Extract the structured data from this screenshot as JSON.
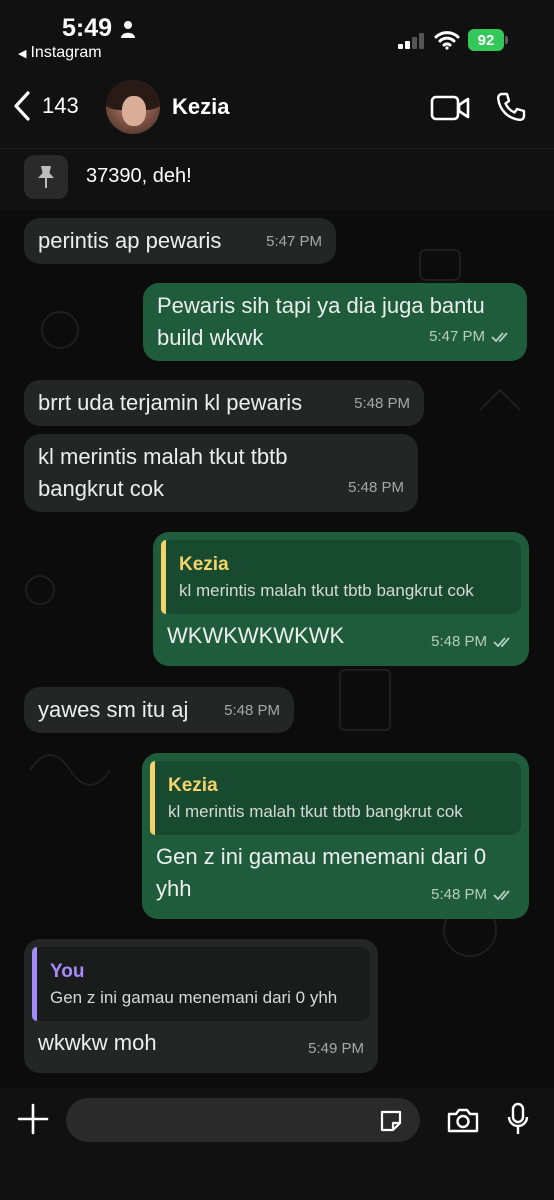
{
  "status_bar": {
    "time": "5:49",
    "back_app": "Instagram",
    "battery": "92"
  },
  "header": {
    "unread_count": "143",
    "contact_name": "Kezia"
  },
  "pinned": {
    "text": "37390, deh!"
  },
  "messages": [
    {
      "direction": "in",
      "lines": [
        "perintis ap pewaris"
      ],
      "time": "5:47 PM"
    },
    {
      "direction": "out",
      "lines": [
        "Pewaris sih tapi ya dia juga bantu",
        "build wkwk"
      ],
      "time": "5:47 PM"
    },
    {
      "direction": "in",
      "lines": [
        "brrt uda terjamin kl pewaris"
      ],
      "time": "5:48 PM"
    },
    {
      "direction": "in",
      "lines": [
        "kl merintis malah tkut tbtb",
        "bangkrut cok"
      ],
      "time": "5:48 PM"
    },
    {
      "direction": "out",
      "quote_author": "Kezia",
      "quote_text": "kl merintis malah tkut tbtb bangkrut cok",
      "lines": [
        "WKWKWKWKWK"
      ],
      "time": "5:48 PM"
    },
    {
      "direction": "in",
      "lines": [
        "yawes sm itu aj"
      ],
      "time": "5:48 PM"
    },
    {
      "direction": "out",
      "quote_author": "Kezia",
      "quote_text": "kl merintis malah tkut tbtb bangkrut cok",
      "lines": [
        "Gen z ini gamau menemani dari 0",
        "yhh"
      ],
      "time": "5:48 PM"
    },
    {
      "direction": "in",
      "quote_author": "You",
      "quote_text": "Gen z ini gamau menemani dari 0 yhh",
      "lines": [
        "wkwkw moh"
      ],
      "time": "5:49 PM"
    }
  ],
  "input": {
    "placeholder": ""
  },
  "colors": {
    "outgoing_bubble": "#1e5c3b",
    "incoming_bubble": "#242626",
    "quote_kezia": "#f6d36a",
    "quote_you": "#a78bfa",
    "battery_green": "#34c759"
  },
  "icons": [
    "person-icon",
    "signal-icon",
    "wifi-icon",
    "battery-icon",
    "chevron-left-icon",
    "video-call-icon",
    "phone-icon",
    "pin-icon",
    "double-check-icon",
    "plus-icon",
    "sticker-icon",
    "camera-icon",
    "microphone-icon"
  ]
}
